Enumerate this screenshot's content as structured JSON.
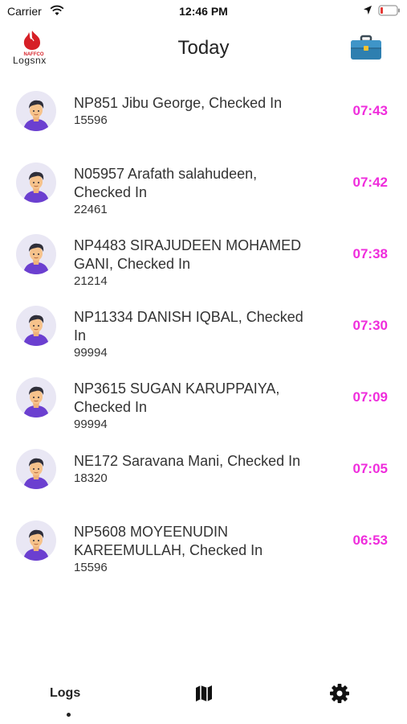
{
  "status_bar": {
    "carrier": "Carrier",
    "time": "12:46 PM"
  },
  "header": {
    "title": "Today",
    "logo_small_text": "NAFFCO",
    "logo_text": "Logsnx"
  },
  "logs": [
    {
      "line1": "NP851 Jibu George, Checked In",
      "line2": "",
      "code": "15596",
      "time": "07:43"
    },
    {
      "line1": "N05957 Arafath salahudeen,",
      "line2": "Checked In",
      "code": "22461",
      "time": "07:42"
    },
    {
      "line1": "NP4483 SIRAJUDEEN MOHAMED",
      "line2": "GANI, Checked In",
      "code": "21214",
      "time": "07:38"
    },
    {
      "line1": "NP11334 DANISH IQBAL, Checked",
      "line2": "In",
      "code": "99994",
      "time": "07:30"
    },
    {
      "line1": "NP3615 SUGAN KARUPPAIYA,",
      "line2": "Checked In",
      "code": "99994",
      "time": "07:09"
    },
    {
      "line1": "NE172 Saravana Mani, Checked In",
      "line2": "",
      "code": "18320",
      "time": "07:05"
    },
    {
      "line1": "NP5608 MOYEENUDIN",
      "line2": "KAREEMULLAH, Checked In",
      "code": "15596",
      "time": "06:53"
    }
  ],
  "bottom_nav": {
    "logs_label": "Logs"
  },
  "colors": {
    "time_accent": "#ef2cdc",
    "avatar_bg": "#e9e7f4",
    "shirt": "#6b3fd0"
  }
}
